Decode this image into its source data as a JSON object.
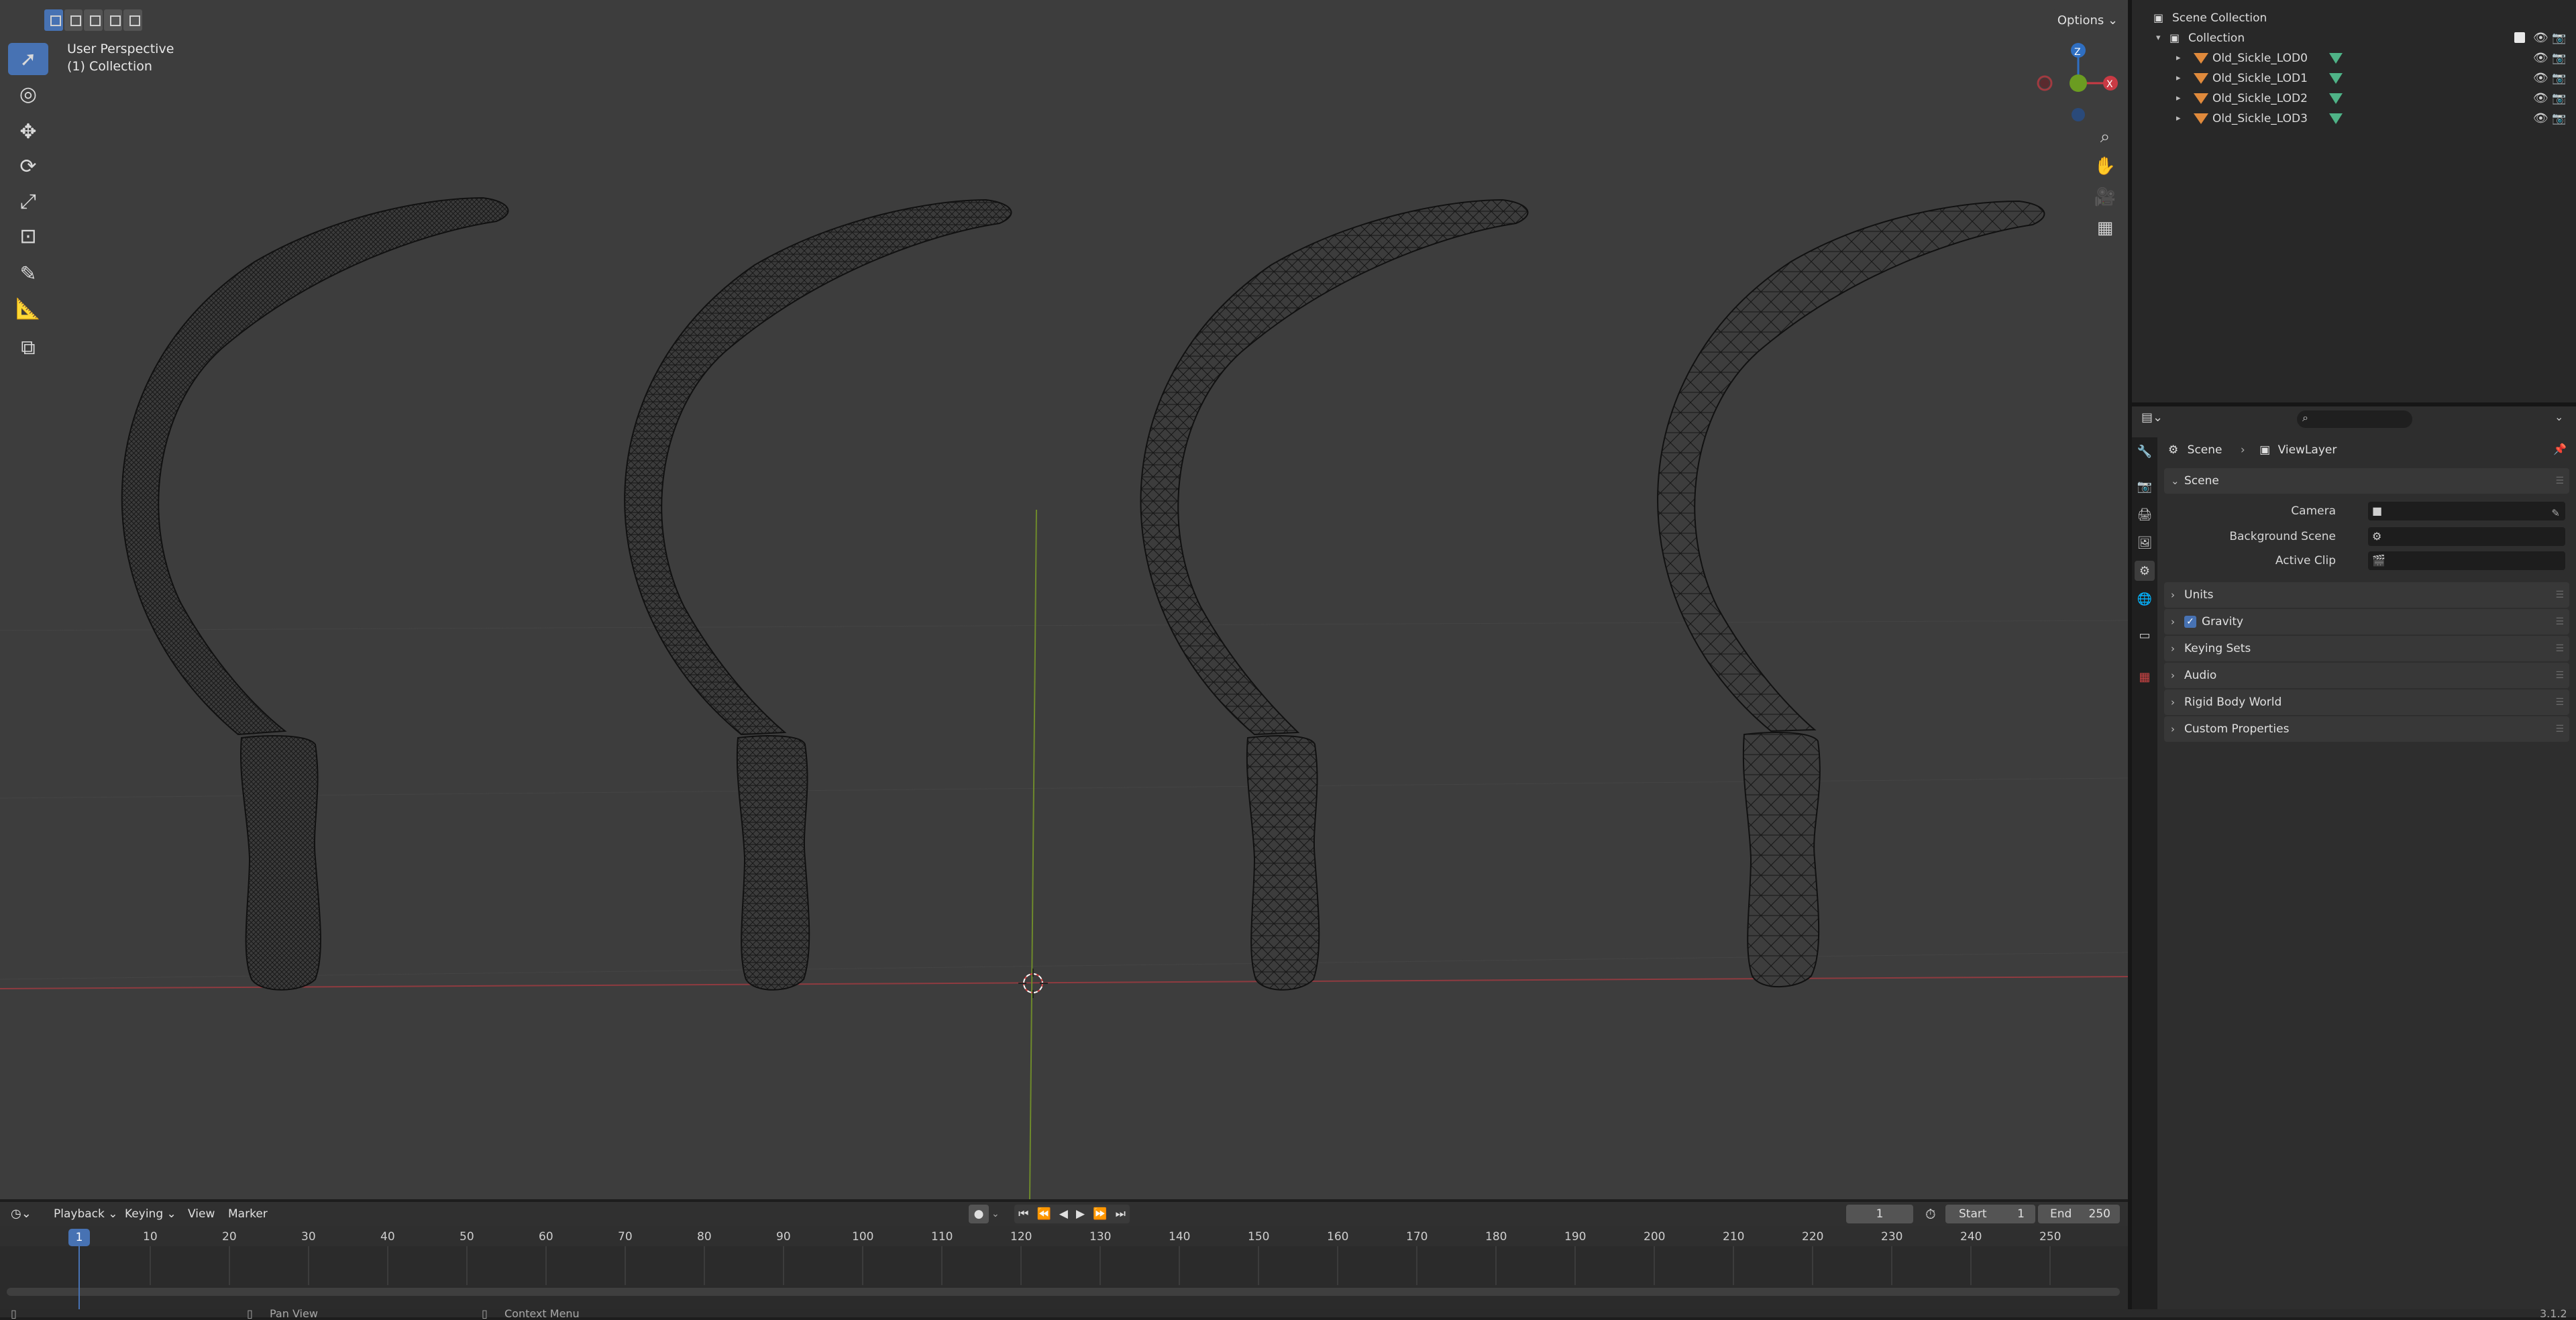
{
  "viewport": {
    "perspective_label": "User Perspective",
    "collection_label": "(1) Collection",
    "options_label": "Options",
    "gizmo": {
      "z": "Z",
      "y": "Y",
      "x": "X"
    }
  },
  "toolbar": {
    "tools": [
      "select-box-icon",
      "cursor-icon",
      "move-icon",
      "rotate-icon",
      "scale-icon",
      "transform-icon",
      "annotate-icon",
      "measure-icon",
      "add-cube-icon"
    ]
  },
  "outliner": {
    "root": "Scene Collection",
    "collection": "Collection",
    "items": [
      {
        "name": "Old_Sickle_LOD0"
      },
      {
        "name": "Old_Sickle_LOD1"
      },
      {
        "name": "Old_Sickle_LOD2"
      },
      {
        "name": "Old_Sickle_LOD3"
      }
    ]
  },
  "properties": {
    "breadcrumb": {
      "scene": "Scene",
      "view_layer": "ViewLayer"
    },
    "scene_panel": {
      "title": "Scene",
      "fields": [
        {
          "label": "Camera"
        },
        {
          "label": "Background Scene"
        },
        {
          "label": "Active Clip"
        }
      ]
    },
    "panels": [
      "Units",
      "Gravity",
      "Keying Sets",
      "Audio",
      "Rigid Body World",
      "Custom Properties"
    ]
  },
  "timeline": {
    "menus": {
      "playback": "Playback",
      "keying": "Keying",
      "view": "View",
      "marker": "Marker"
    },
    "current_frame": "1",
    "start_label": "Start",
    "start_value": "1",
    "end_label": "End",
    "end_value": "250",
    "frame_labels": [
      "1",
      "10",
      "20",
      "30",
      "40",
      "50",
      "60",
      "70",
      "80",
      "90",
      "100",
      "110",
      "120",
      "130",
      "140",
      "150",
      "160",
      "170",
      "180",
      "190",
      "200",
      "210",
      "220",
      "230",
      "240",
      "250"
    ]
  },
  "status_bar": {
    "pan_view": "Pan View",
    "context_menu": "Context Menu",
    "version": "3.1.2"
  },
  "colors": {
    "accent": "#4772b3",
    "object_icon": "#e08a3c",
    "mesh_icon": "#4fb387",
    "x_axis": "#c93a44",
    "y_axis": "#6b9c21",
    "z_axis": "#2f6fc2"
  }
}
